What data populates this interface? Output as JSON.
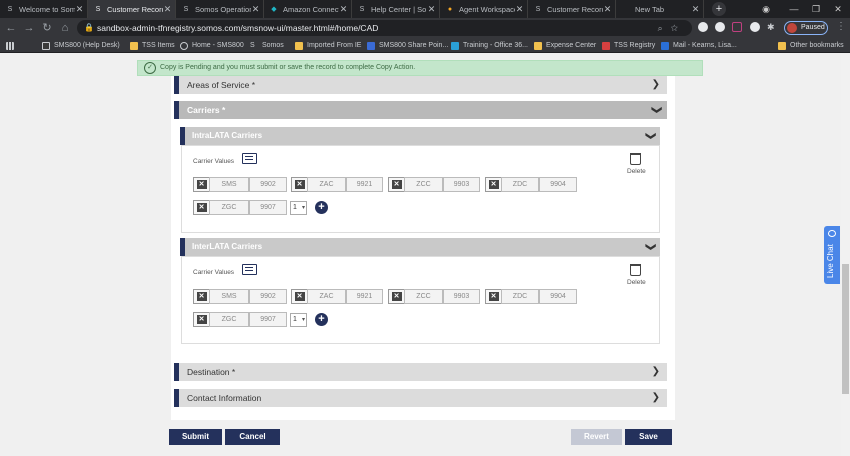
{
  "tabs": [
    {
      "label": "Welcome to Somos",
      "favicon": "somos-icon",
      "active": false
    },
    {
      "label": "Customer Record",
      "favicon": "somos-icon",
      "active": true
    },
    {
      "label": "Somos Operation",
      "favicon": "somos-icon",
      "active": false
    },
    {
      "label": "Amazon Connect",
      "favicon": "amazon-connect-icon",
      "active": false
    },
    {
      "label": "Help Center | So",
      "favicon": "somos-icon",
      "active": false
    },
    {
      "label": "Agent Workspace",
      "favicon": "agent-workspace-icon",
      "active": false
    },
    {
      "label": "Customer Record",
      "favicon": "somos-icon",
      "active": false
    },
    {
      "label": "New Tab",
      "favicon": "",
      "active": false
    }
  ],
  "browser": {
    "url": "sandbox-admin-tfnregistry.somos.com/smsnow-ui/master.html#/home/CAD",
    "profile_label": "Paused"
  },
  "bookmarks": [
    {
      "label": "SMS800 (Help Desk)",
      "icon": "sms800-icon"
    },
    {
      "label": "TSS Items",
      "icon": "folder-icon"
    },
    {
      "label": "Home - SMS800",
      "icon": "globe-icon"
    },
    {
      "label": "Somos",
      "icon": "somos-icon"
    },
    {
      "label": "Imported From IE",
      "icon": "folder-icon"
    },
    {
      "label": "SMS800 Share Poin...",
      "icon": "sharepoint-icon"
    },
    {
      "label": "Training - Office 36...",
      "icon": "office-icon"
    },
    {
      "label": "Expense Center",
      "icon": "expense-icon"
    },
    {
      "label": "TSS Registry",
      "icon": "registry-icon"
    },
    {
      "label": "Mail - Kearns, Lisa...",
      "icon": "mail-icon"
    },
    {
      "label": "Other bookmarks",
      "icon": "folder-icon"
    }
  ],
  "banner": {
    "text": "Copy is Pending and you must submit or save the record to complete Copy Action."
  },
  "sections": {
    "areas_of_service": "Areas of Service *",
    "carriers": "Carriers *",
    "destination": "Destination *",
    "contact_information": "Contact Information"
  },
  "intralata": {
    "title": "IntraLATA Carriers",
    "carrier_values_label": "Carrier Values",
    "delete_label": "Delete",
    "carriers": [
      {
        "code": "SMS",
        "value": "9902"
      },
      {
        "code": "ZAC",
        "value": "9921"
      },
      {
        "code": "ZCC",
        "value": "9903"
      },
      {
        "code": "ZDC",
        "value": "9904"
      },
      {
        "code": "ZGC",
        "value": "9907"
      }
    ],
    "select_value": "1"
  },
  "interlata": {
    "title": "InterLATA Carriers",
    "carrier_values_label": "Carrier Values",
    "delete_label": "Delete",
    "carriers": [
      {
        "code": "SMS",
        "value": "9902"
      },
      {
        "code": "ZAC",
        "value": "9921"
      },
      {
        "code": "ZCC",
        "value": "9903"
      },
      {
        "code": "ZDC",
        "value": "9904"
      },
      {
        "code": "ZGC",
        "value": "9907"
      }
    ],
    "select_value": "1"
  },
  "actions": {
    "submit": "Submit",
    "cancel": "Cancel",
    "revert": "Revert",
    "save": "Save"
  },
  "live_chat": {
    "label": "Live Chat"
  },
  "colors": {
    "navy": "#24315c",
    "banner_bg": "#c3e6cb",
    "revert_disabled": "#c4c8d4",
    "live_chat": "#4a86e8"
  }
}
